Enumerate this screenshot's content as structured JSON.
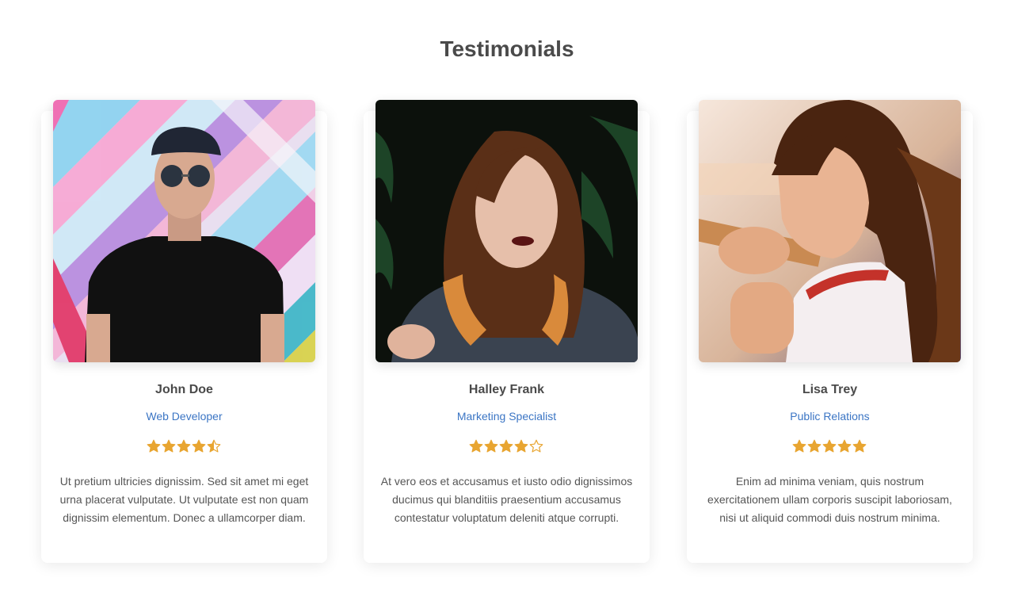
{
  "header": {
    "title": "Testimonials"
  },
  "colors": {
    "accent": "#3b75c4",
    "star": "#e8a531",
    "heading": "#4a4a4a",
    "body_text": "#555555"
  },
  "testimonials": [
    {
      "name": "John Doe",
      "role": "Web Developer",
      "rating": 4.5,
      "rating_max": 5,
      "photo_icon": "man-portrait-photo",
      "quote": "Ut pretium ultricies dignissim. Sed sit amet mi eget urna placerat vulputate. Ut vulputate est non quam dignissim elementum. Donec a ullamcorper diam."
    },
    {
      "name": "Halley Frank",
      "role": "Marketing Specialist",
      "rating": 4,
      "rating_max": 5,
      "photo_icon": "woman-portrait-photo",
      "quote": "At vero eos et accusamus et iusto odio dignissimos ducimus qui blanditiis praesentium accusamus contestatur voluptatum deleniti atque corrupti."
    },
    {
      "name": "Lisa Trey",
      "role": "Public Relations",
      "rating": 5,
      "rating_max": 5,
      "photo_icon": "woman-portrait-photo",
      "quote": "Enim ad minima veniam, quis nostrum exercitationem ullam corporis suscipit laboriosam, nisi ut aliquid commodi duis nostrum minima."
    }
  ]
}
